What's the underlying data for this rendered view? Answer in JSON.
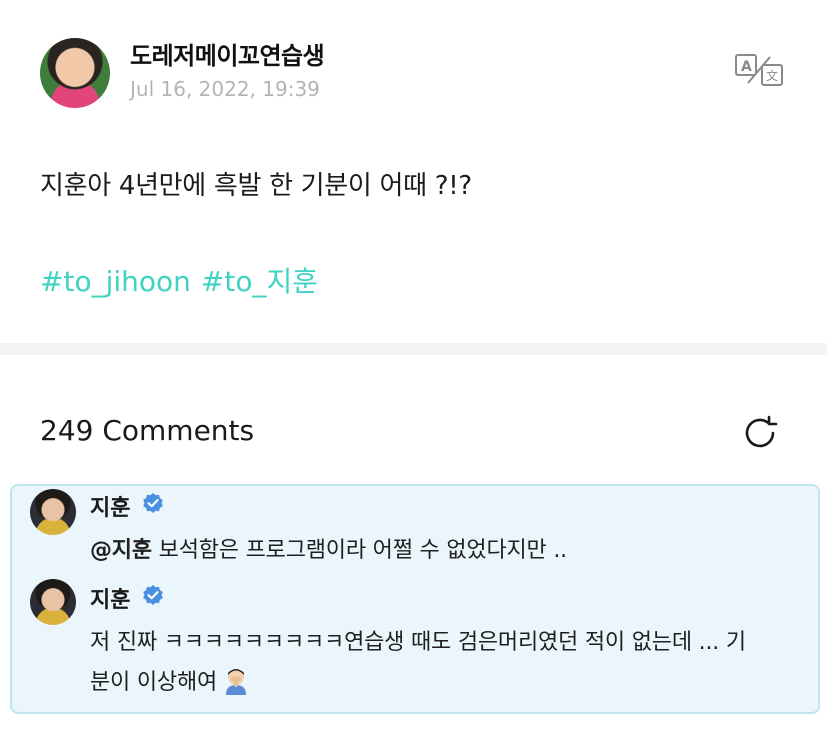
{
  "post": {
    "author": "도레저메이꼬연습생",
    "date": "Jul 16, 2022, 19:39",
    "text": "지훈아 4년만에 흑발 한 기분이 어때 ?!?",
    "hashtags": [
      "#to_jihoon",
      "#to_지훈"
    ],
    "icons": {
      "translate": "translate-icon"
    }
  },
  "comments": {
    "count_label": "249 Comments",
    "refresh_icon": "refresh-icon"
  },
  "thread": {
    "items": [
      {
        "name": "지훈",
        "verified": true,
        "mention": "@지훈",
        "text": " 보석함은 프로그램이라 어쩔 수 없었다지만 .."
      },
      {
        "name": "지훈",
        "verified": true,
        "text_line1": "저 진짜 ㅋㅋㅋㅋㅋㅋㅋㅋㅋ연습생 때도 검은머리였던 적이 없는데 ... 기",
        "text_line2": "분이 이상해여",
        "emoji": "person-facepalming"
      }
    ]
  },
  "colors": {
    "hashtag": "#3fd3c3",
    "verified": "#4a90e2",
    "thread_bg": "#eaf6fb",
    "thread_border": "#bfe6ef",
    "date": "#b4b4b4"
  }
}
